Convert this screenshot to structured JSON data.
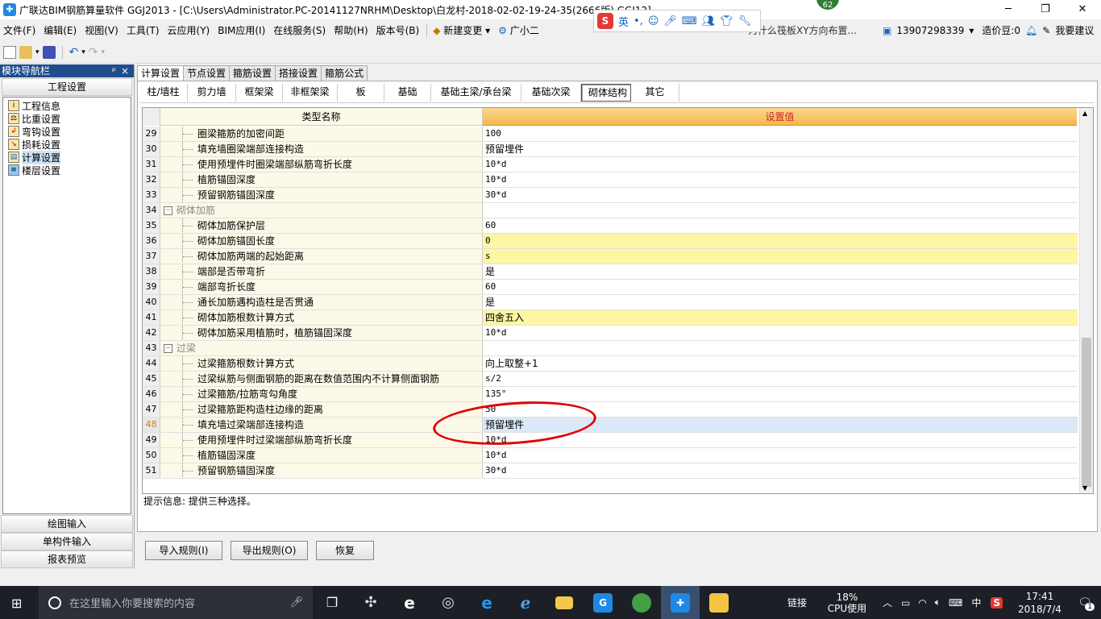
{
  "window": {
    "title": "广联达BIM钢筋算量软件 GGJ2013 - [C:\\Users\\Administrator.PC-20141127NRHM\\Desktop\\白龙村-2018-02-02-19-24-35(2666版).GGJ12]",
    "controls": [
      "─",
      "❐",
      "✕"
    ]
  },
  "ime": {
    "lang": "英",
    "badge": "62"
  },
  "menu": {
    "items": [
      "文件(F)",
      "编辑(E)",
      "视图(V)",
      "工具(T)",
      "云应用(Y)",
      "BIM应用(I)",
      "在线服务(S)",
      "帮助(H)",
      "版本号(B)"
    ],
    "new_change": "新建变更",
    "assistant": "广小二",
    "question": "为什么筏板XY方向布置...",
    "phone": "13907298339",
    "coins": "造价豆:0",
    "suggest": "我要建议"
  },
  "nav": {
    "title": "模块导航栏",
    "pin": "ᵖ",
    "close": "×",
    "header": "工程设置",
    "items": [
      {
        "label": "工程信息",
        "icon": "info-icon"
      },
      {
        "label": "比重设置",
        "icon": "weight-icon"
      },
      {
        "label": "弯钩设置",
        "icon": "hook-icon"
      },
      {
        "label": "损耗设置",
        "icon": "loss-icon"
      },
      {
        "label": "计算设置",
        "icon": "calc-settings-icon"
      },
      {
        "label": "楼层设置",
        "icon": "floor-icon"
      }
    ],
    "bottom": [
      "绘图输入",
      "单构件输入",
      "报表预览"
    ]
  },
  "top_tabs": [
    "计算设置",
    "节点设置",
    "箍筋设置",
    "搭接设置",
    "箍筋公式"
  ],
  "sub_tabs": [
    "柱/墙柱",
    "剪力墙",
    "框架梁",
    "非框架梁",
    "板",
    "基础",
    "基础主梁/承台梁",
    "基础次梁",
    "砌体结构",
    "其它"
  ],
  "grid": {
    "col_name": "类型名称",
    "col_value": "设置值",
    "rows": [
      {
        "n": "29",
        "name": "圈梁箍筋的加密间距",
        "value": "100"
      },
      {
        "n": "30",
        "name": "填充墙圈梁端部连接构造",
        "value": "预留埋件"
      },
      {
        "n": "31",
        "name": "使用预埋件时圈梁端部纵筋弯折长度",
        "value": "10*d"
      },
      {
        "n": "32",
        "name": "植筋锚固深度",
        "value": "10*d"
      },
      {
        "n": "33",
        "name": "预留钢筋锚固深度",
        "value": "30*d"
      },
      {
        "n": "34",
        "name": "砌体加筋",
        "value": "",
        "group": true
      },
      {
        "n": "35",
        "name": "砌体加筋保护层",
        "value": "60"
      },
      {
        "n": "36",
        "name": "砌体加筋锚固长度",
        "value": "0",
        "highlight": true
      },
      {
        "n": "37",
        "name": "砌体加筋两端的起始距离",
        "value": "s",
        "highlight": true
      },
      {
        "n": "38",
        "name": "端部是否带弯折",
        "value": "是"
      },
      {
        "n": "39",
        "name": "端部弯折长度",
        "value": "60"
      },
      {
        "n": "40",
        "name": "通长加筋遇构造柱是否贯通",
        "value": "是"
      },
      {
        "n": "41",
        "name": "砌体加筋根数计算方式",
        "value": "四舍五入",
        "highlight": true
      },
      {
        "n": "42",
        "name": "砌体加筋采用植筋时，植筋锚固深度",
        "value": "10*d"
      },
      {
        "n": "43",
        "name": "过梁",
        "value": "",
        "group": true
      },
      {
        "n": "44",
        "name": "过梁箍筋根数计算方式",
        "value": "向上取整+1"
      },
      {
        "n": "45",
        "name": "过梁纵筋与侧面钢筋的距离在数值范围内不计算侧面钢筋",
        "value": "s/2"
      },
      {
        "n": "46",
        "name": "过梁箍筋/拉筋弯勾角度",
        "value": "135°"
      },
      {
        "n": "47",
        "name": "过梁箍筋距构造柱边缘的距离",
        "value": "50"
      },
      {
        "n": "48",
        "name": "填充墙过梁端部连接构造",
        "value": "预留埋件",
        "selected": true
      },
      {
        "n": "49",
        "name": "使用预埋件时过梁端部纵筋弯折长度",
        "value": "10*d"
      },
      {
        "n": "50",
        "name": "植筋锚固深度",
        "value": "10*d"
      },
      {
        "n": "51",
        "name": "预留钢筋锚固深度",
        "value": "30*d"
      }
    ]
  },
  "hint": "提示信息: 提供三种选择。",
  "buttons": {
    "import": "导入规则(I)",
    "export": "导出规则(O)",
    "restore": "恢复"
  },
  "taskbar": {
    "search_placeholder": "在这里输入你要搜索的内容",
    "link": "链接",
    "cpu_pct": "18%",
    "cpu_label": "CPU使用",
    "ime": "中",
    "time": "17:41",
    "date": "2018/7/4",
    "notify_count": "1"
  },
  "colors": {
    "accent": "#1f4e8c",
    "highlight": "#fdf6a3",
    "header": "#f5b74a",
    "annotation": "#e00000"
  }
}
